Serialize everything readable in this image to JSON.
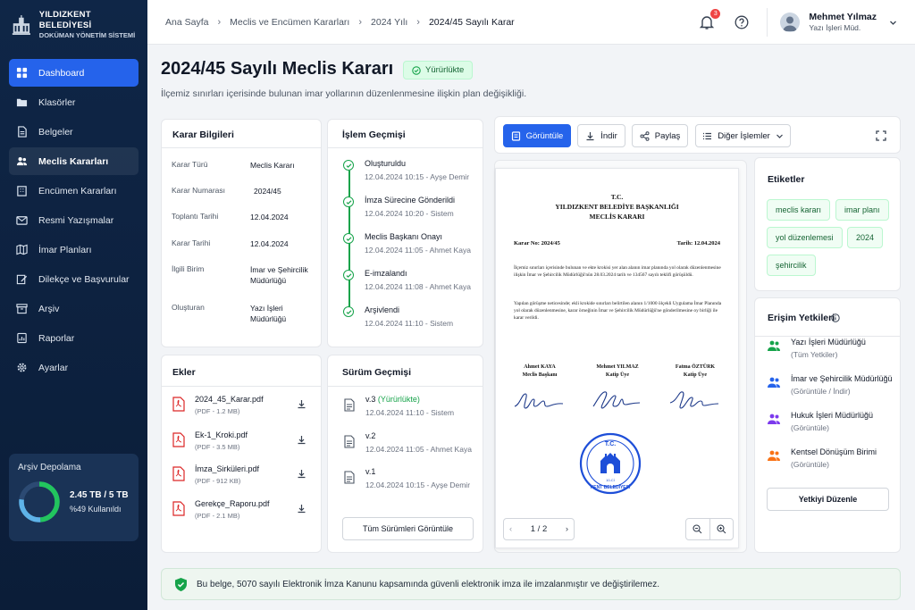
{
  "brand": {
    "title": "YILDIZKENT BELEDİYESİ",
    "subtitle": "DOKÜMAN YÖNETİM SİSTEMİ"
  },
  "sidebar": {
    "items": [
      {
        "label": "Dashboard",
        "icon": "dashboard-icon"
      },
      {
        "label": "Klasörler",
        "icon": "folder-icon"
      },
      {
        "label": "Belgeler",
        "icon": "document-icon"
      },
      {
        "label": "Meclis Kararları",
        "icon": "users-icon"
      },
      {
        "label": "Encümen Kararları",
        "icon": "building-icon"
      },
      {
        "label": "Resmi Yazışmalar",
        "icon": "mail-icon"
      },
      {
        "label": "İmar Planları",
        "icon": "map-icon"
      },
      {
        "label": "Dilekçe ve Başvurular",
        "icon": "edit-icon"
      },
      {
        "label": "Arşiv",
        "icon": "archive-icon"
      },
      {
        "label": "Raporlar",
        "icon": "report-icon"
      },
      {
        "label": "Ayarlar",
        "icon": "gear-icon"
      }
    ],
    "storage": {
      "title": "Arşiv Depolama",
      "used": "2.45 TB / 5 TB",
      "percent_label": "%49 Kullanıldı",
      "percent": 49
    }
  },
  "breadcrumb": [
    "Ana Sayfa",
    "Meclis ve Encümen Kararları",
    "2024 Yılı",
    "2024/45 Sayılı Karar"
  ],
  "header": {
    "notifications": "3",
    "user_name": "Mehmet Yılmaz",
    "user_role": "Yazı İşleri Müd."
  },
  "page": {
    "title": "2024/45 Sayılı Meclis Kararı",
    "status": "Yürürlükte",
    "description": "İlçemiz sınırları içerisinde bulunan imar yollarının düzenlenmesine ilişkin plan değişikliği."
  },
  "info": {
    "title": "Karar Bilgileri",
    "rows": [
      {
        "k": "Karar Türü",
        "v": "Meclis Kararı"
      },
      {
        "k": "Karar Numarası",
        "v": "2024/45"
      },
      {
        "k": "Toplantı Tarihi",
        "v": "12.04.2024"
      },
      {
        "k": "Karar Tarihi",
        "v": "12.04.2024"
      },
      {
        "k": "İlgili Birim",
        "v": "İmar ve Şehircilik Müdürlüğü"
      },
      {
        "k": "Oluşturan",
        "v": "Yazı İşleri Müdürlüğü"
      }
    ]
  },
  "history": {
    "title": "İşlem Geçmişi",
    "items": [
      {
        "name": "Oluşturuldu",
        "meta": "12.04.2024 10:15 - Ayşe Demir"
      },
      {
        "name": "İmza Sürecine Gönderildi",
        "meta": "12.04.2024 10:20 - Sistem"
      },
      {
        "name": "Meclis Başkanı Onayı",
        "meta": "12.04.2024 11:05 - Ahmet Kaya"
      },
      {
        "name": "E-imzalandı",
        "meta": "12.04.2024 11:08 - Ahmet Kaya"
      },
      {
        "name": "Arşivlendi",
        "meta": "12.04.2024 11:10 - Sistem"
      }
    ]
  },
  "attachments": {
    "title": "Ekler",
    "items": [
      {
        "name": "2024_45_Karar.pdf",
        "meta": "(PDF - 1.2 MB)"
      },
      {
        "name": "Ek-1_Kroki.pdf",
        "meta": "(PDF - 3.5 MB)"
      },
      {
        "name": "İmza_Sirküleri.pdf",
        "meta": "(PDF - 912 KB)"
      },
      {
        "name": "Gerekçe_Raporu.pdf",
        "meta": "(PDF - 2.1 MB)"
      }
    ]
  },
  "versions": {
    "title": "Sürüm Geçmişi",
    "items": [
      {
        "name": "v.3",
        "status": "(Yürürlükte)",
        "meta": "12.04.2024 11:10 - Sistem"
      },
      {
        "name": "v.2",
        "status": "",
        "meta": "12.04.2024 11:05 - Ahmet Kaya"
      },
      {
        "name": "v.1",
        "status": "",
        "meta": "12.04.2024 10:15 - Ayşe Demir"
      }
    ],
    "all_button": "Tüm Sürümleri Görüntüle"
  },
  "toolbar": {
    "view": "Görüntüle",
    "download": "İndir",
    "share": "Paylaş",
    "more": "Diğer İşlemler"
  },
  "document": {
    "line1": "T.C.",
    "line2": "YILDIZKENT BELEDİYE BAŞKANLIĞI",
    "line3": "MECLİS KARARI",
    "number": "Karar No: 2024/45",
    "date": "Tarih: 12.04.2024",
    "para1": "İlçemiz sınırları içerisinde bulunan ve ekte krokisi yer alan alanın imar planında yol olarak düzenlenmesine ilişkin İmar ve Şehircilik Müdürlüğü'nün 28.03.2024 tarih ve 134567 sayılı teklifi görüşüldü.",
    "para2": "Yapılan görüşme neticesinde; ekli krokide sınırları belirtilen alanın 1/1000 ölçekli Uygulama İmar Planında yol olarak düzenlenmesine, karar örneğinin İmar ve Şehircilik Müdürlüğü'ne gönderilmesine oy birliği ile karar verildi.",
    "signers": [
      {
        "name": "Ahmet KAYA",
        "role": "Meclis Başkanı"
      },
      {
        "name": "Mehmet YILMAZ",
        "role": "Katip Üye"
      },
      {
        "name": "Fatma ÖZTÜRK",
        "role": "Katip Üye"
      }
    ],
    "seal_top": "T.C.",
    "seal_bottom": "KENT BELEDİYESİ",
    "seal_year": "10-Cİ",
    "page": "1 / 2"
  },
  "tags": {
    "title": "Etiketler",
    "items": [
      "meclis kararı",
      "imar planı",
      "yol düzenlemesi",
      "2024",
      "şehircilik"
    ]
  },
  "access": {
    "title": "Erişim Yetkileri",
    "items": [
      {
        "name": "Yazı İşleri Müdürlüğü",
        "role": "(Tüm Yetkiler)",
        "color": "#16a34a"
      },
      {
        "name": "İmar ve Şehircilik Müdürlüğü",
        "role": "(Görüntüle / İndir)",
        "color": "#2563eb"
      },
      {
        "name": "Hukuk İşleri Müdürlüğü",
        "role": "(Görüntüle)",
        "color": "#7c3aed"
      },
      {
        "name": "Kentsel Dönüşüm Birimi",
        "role": "(Görüntüle)",
        "color": "#f97316"
      }
    ],
    "edit_button": "Yetkiyi Düzenle"
  },
  "footer": {
    "text": "Bu belge, 5070 sayılı Elektronik İmza Kanunu kapsamında güvenli elektronik imza ile imzalanmıştır ve değiştirilemez."
  }
}
